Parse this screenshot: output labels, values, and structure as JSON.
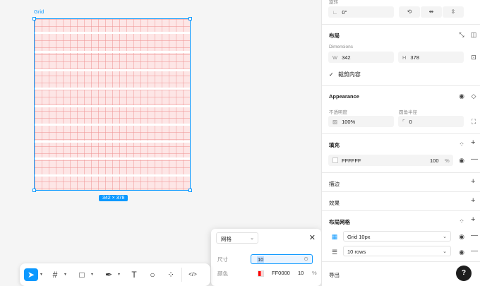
{
  "canvas": {
    "frame_label": "Grid",
    "dimension_badge": "342 × 378"
  },
  "popup": {
    "type_select": "网格",
    "size_label": "尺寸",
    "size_value": "10",
    "color_label": "颜色",
    "color_hex": "FF0000",
    "color_opacity": "10",
    "percent": "%"
  },
  "toolbar": {
    "code_label": "</>"
  },
  "panel": {
    "rotation": {
      "label": "旋转",
      "value": "0°"
    },
    "layout": {
      "title": "布局",
      "dimensions_label": "Dimensions",
      "width_prefix": "W",
      "width": "342",
      "height_prefix": "H",
      "height": "378",
      "clip_content": "裁剪内容"
    },
    "appearance": {
      "title": "Appearance",
      "opacity_label": "不透明度",
      "opacity_value": "100%",
      "radius_label": "圆角半径",
      "radius_value": "0"
    },
    "fill": {
      "title": "填充",
      "hex": "FFFFFF",
      "opacity": "100",
      "percent": "%"
    },
    "stroke": {
      "title": "描边"
    },
    "effects": {
      "title": "效果"
    },
    "layout_grid": {
      "title": "布局网格",
      "grid1": "Grid 10px",
      "grid2": "10 rows"
    },
    "export": {
      "title": "导出"
    },
    "help": "?"
  },
  "colors": {
    "accent": "#0d99ff",
    "grid_red": "#FF0000"
  }
}
